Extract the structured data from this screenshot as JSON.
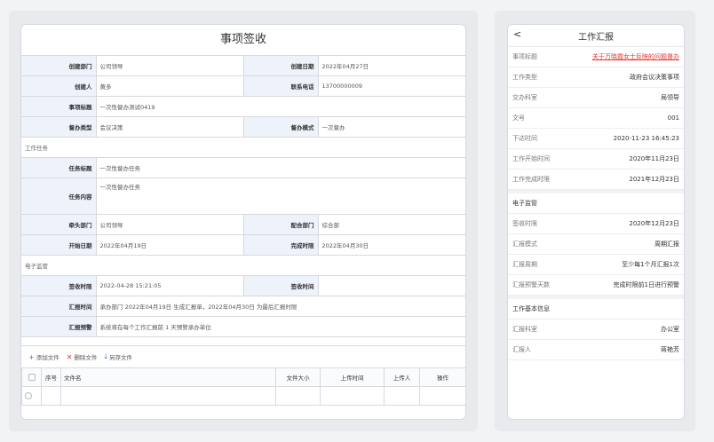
{
  "form": {
    "title": "事项签收",
    "create_dept_label": "创建部门",
    "create_dept": "公司领导",
    "create_date_label": "创建日期",
    "create_date": "2022年04月27日",
    "creator_label": "创建人",
    "creator": "黄多",
    "phone_label": "联系电话",
    "phone": "13700000009",
    "subject_label": "事项标题",
    "subject": "一次性督办测试0419",
    "type_label": "督办类型",
    "type": "会议决策",
    "mode_label": "督办模式",
    "mode": "一次督办",
    "task_section": "工作任务",
    "task_title_label": "任务标题",
    "task_title": "一次性督办任务",
    "task_content_label": "任务内容",
    "task_content": "一次性督办任务",
    "lead_dept_label": "牵头部门",
    "lead_dept": "公司领导",
    "coop_dept_label": "配合部门",
    "coop_dept": "综合部",
    "start_date_label": "开始日期",
    "start_date": "2022年04月19日",
    "deadline_label": "完成时限",
    "deadline": "2022年04月30日",
    "supervise_section": "电子监管",
    "sign_time_label": "签收时限",
    "sign_time": "2022-04-28 15:21:05",
    "sign_at_label": "签收时间",
    "sign_at": "",
    "report_time_label": "汇报时间",
    "report_time": "承办部门 2022年04月19日 生成汇报单，2022年04月30日 为最后汇报时限",
    "report_warn_label": "汇报预警",
    "report_warn": "系统将在每个工作汇报前 1 天预警承办单位"
  },
  "files": {
    "add": "添加文件",
    "delete": "删除文件",
    "save_as": "另存文件",
    "columns": [
      "序号",
      "文件名",
      "文件大小",
      "上传时间",
      "上传人",
      "操作"
    ]
  },
  "mobile": {
    "title": "工作汇报",
    "rows1": [
      {
        "k": "事项标题",
        "v": "关于万晓霞女士反映的问题督办",
        "link": true
      },
      {
        "k": "工作类型",
        "v": "政府会议决策事项"
      },
      {
        "k": "交办科室",
        "v": "局领导"
      },
      {
        "k": "文号",
        "v": "001"
      },
      {
        "k": "下达时间",
        "v": "2020-11-23 16:45:23"
      },
      {
        "k": "工作开始时间",
        "v": "2020年11月23日"
      },
      {
        "k": "工作完成时限",
        "v": "2021年12月23日"
      }
    ],
    "sec2": "电子监管",
    "rows2": [
      {
        "k": "签收时限",
        "v": "2020年12月23日"
      },
      {
        "k": "汇报模式",
        "v": "周期汇报"
      },
      {
        "k": "汇报周期",
        "v": "至少每1个月汇报1次"
      },
      {
        "k": "汇报预警天数",
        "v": "完成时限前1日进行预警"
      }
    ],
    "sec3": "工作基本信息",
    "rows3": [
      {
        "k": "汇报科室",
        "v": "办公室"
      },
      {
        "k": "汇报人",
        "v": "蒋艳芳"
      }
    ]
  }
}
